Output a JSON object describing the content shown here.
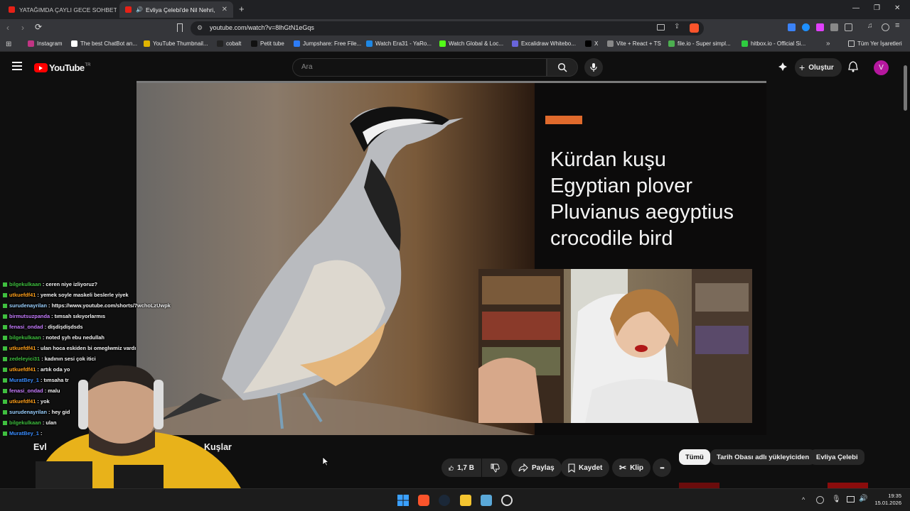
{
  "browser": {
    "tabs": [
      {
        "title": "YATAĞIMDA ÇAYLI GECE SOHBETİM"
      },
      {
        "title": "Evliya Çelebi'de Nil Nehri, Tin"
      }
    ],
    "new_tab_label": "+",
    "url": "youtube.com/watch?v=8lhGtN1eGqs",
    "bookmarks": [
      {
        "label": "Instagram",
        "color": "#c13584"
      },
      {
        "label": "The best ChatBot an...",
        "color": "#ffffff"
      },
      {
        "label": "YouTube Thumbnail...",
        "color": "#e0b400"
      },
      {
        "label": "cobalt",
        "color": "#222222"
      },
      {
        "label": "Petit tube",
        "color": "#111111"
      },
      {
        "label": "Jumpshare: Free File...",
        "color": "#2d7cf6"
      },
      {
        "label": "Watch Era31 - YaRo...",
        "color": "#1e88e5"
      },
      {
        "label": "Watch Global & Loc...",
        "color": "#53fc18"
      },
      {
        "label": "Excalidraw Whitebo...",
        "color": "#6965db"
      },
      {
        "label": "X",
        "color": "#000000"
      },
      {
        "label": "Vite + React + TS",
        "color": "#888888"
      },
      {
        "label": "file.io - Super simpl...",
        "color": "#4caf50"
      },
      {
        "label": "hitbox.io - Official Si...",
        "color": "#2ecc40"
      }
    ],
    "all_bookmarks_label": "Tüm Yer İşaretleri"
  },
  "youtube": {
    "logo_text": "YouTube",
    "logo_region": "TR",
    "search_placeholder": "Ara",
    "create_label": "Oluştur",
    "avatar_letter": "V",
    "avatar_color": "#b5179e"
  },
  "video": {
    "slide_lines": [
      "Kürdan kuşu",
      "Egyptian plover",
      "Pluvianus aegyptius",
      "crocodile bird"
    ],
    "slide_accent": "#e06a2c",
    "title_left": "Evl",
    "title_right": "Kuşlar"
  },
  "chat": [
    {
      "user": "bilgekulkaan",
      "color": "#3fbf3f",
      "msg": "ceren niye izliyoruz?"
    },
    {
      "user": "utkuefdf41",
      "color": "#ff9f1a",
      "msg": "yemek soyle maskeli beslerle yiyek"
    },
    {
      "user": "surudenayrilan",
      "color": "#9ad0ff",
      "msg": "https://www.youtube.com/shorts/7wchoLzUwpk"
    },
    {
      "user": "birmutsuzpanda",
      "color": "#c77dff",
      "msg": "tımsah sıkıyorlarmıs"
    },
    {
      "user": "fenasi_ondad",
      "color": "#c77dff",
      "msg": "dişdişdişdsds"
    },
    {
      "user": "bilgekulkaan",
      "color": "#3fbf3f",
      "msg": "noted şyh ebu nedullah"
    },
    {
      "user": "utkuefdf41",
      "color": "#ff9f1a",
      "msg": "ulan hoca eskiden bi omeglwmiz vardı"
    },
    {
      "user": "zedeleyici31",
      "color": "#3fbf3f",
      "msg": "kadının sesi çok itici"
    },
    {
      "user": "utkuefdf41",
      "color": "#ff9f1a",
      "msg": "artık oda yo"
    },
    {
      "user": "MuratBey_1",
      "color": "#3a8dff",
      "msg": "tımsaha tr"
    },
    {
      "user": "fenasi_ondad",
      "color": "#c77dff",
      "msg": "malu"
    },
    {
      "user": "utkuefdf41",
      "color": "#ff9f1a",
      "msg": "yok"
    },
    {
      "user": "surudenayrilan",
      "color": "#9ad0ff",
      "msg": "hey gid"
    },
    {
      "user": "bilgekulkaan",
      "color": "#3fbf3f",
      "msg": "ulan"
    },
    {
      "user": "MuratBey_1",
      "color": "#3a8dff",
      "msg": ""
    }
  ],
  "actions": {
    "likes": "1,7 B",
    "share": "Paylaş",
    "save": "Kaydet",
    "clip": "Klip",
    "more": "•••"
  },
  "chips": [
    "Tümü",
    "Tarih Obası adlı yükleyiciden",
    "Evliya Çelebi"
  ],
  "taskbar": {
    "time": "19:35",
    "date": "15.01.2026"
  }
}
